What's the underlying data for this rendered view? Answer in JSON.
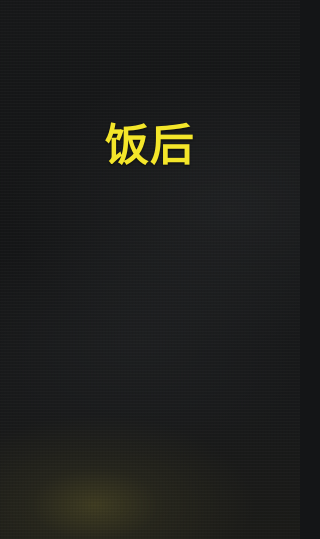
{
  "caption": {
    "text": "饭后",
    "color": "#f4e62a"
  },
  "background": {
    "color": "#141517"
  }
}
